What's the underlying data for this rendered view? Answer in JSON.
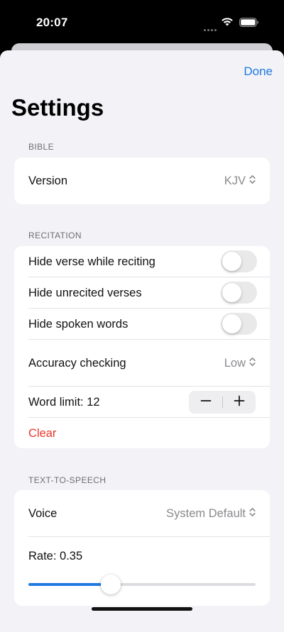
{
  "status_bar": {
    "time": "20:07"
  },
  "nav": {
    "done_label": "Done",
    "title": "Settings"
  },
  "sections": {
    "bible": {
      "header": "BIBLE",
      "version": {
        "label": "Version",
        "value": "KJV"
      }
    },
    "recitation": {
      "header": "RECITATION",
      "hide_verse": {
        "label": "Hide verse while reciting",
        "on": false
      },
      "hide_unrecited": {
        "label": "Hide unrecited verses",
        "on": false
      },
      "hide_spoken": {
        "label": "Hide spoken words",
        "on": false
      },
      "accuracy": {
        "label": "Accuracy checking",
        "value": "Low"
      },
      "word_limit": {
        "label": "Word limit: 12",
        "value": 12
      },
      "clear_label": "Clear"
    },
    "tts": {
      "header": "TEXT-TO-SPEECH",
      "voice": {
        "label": "Voice",
        "value": "System Default"
      },
      "rate": {
        "label": "Rate: 0.35",
        "value": 0.35
      }
    }
  },
  "colors": {
    "accent": "#1f7ae0",
    "destructive": "#e8362c",
    "background": "#f2f2f7"
  },
  "icons": [
    "wifi-icon",
    "battery-icon",
    "chevron-up-down-icon",
    "minus-icon",
    "plus-icon"
  ]
}
